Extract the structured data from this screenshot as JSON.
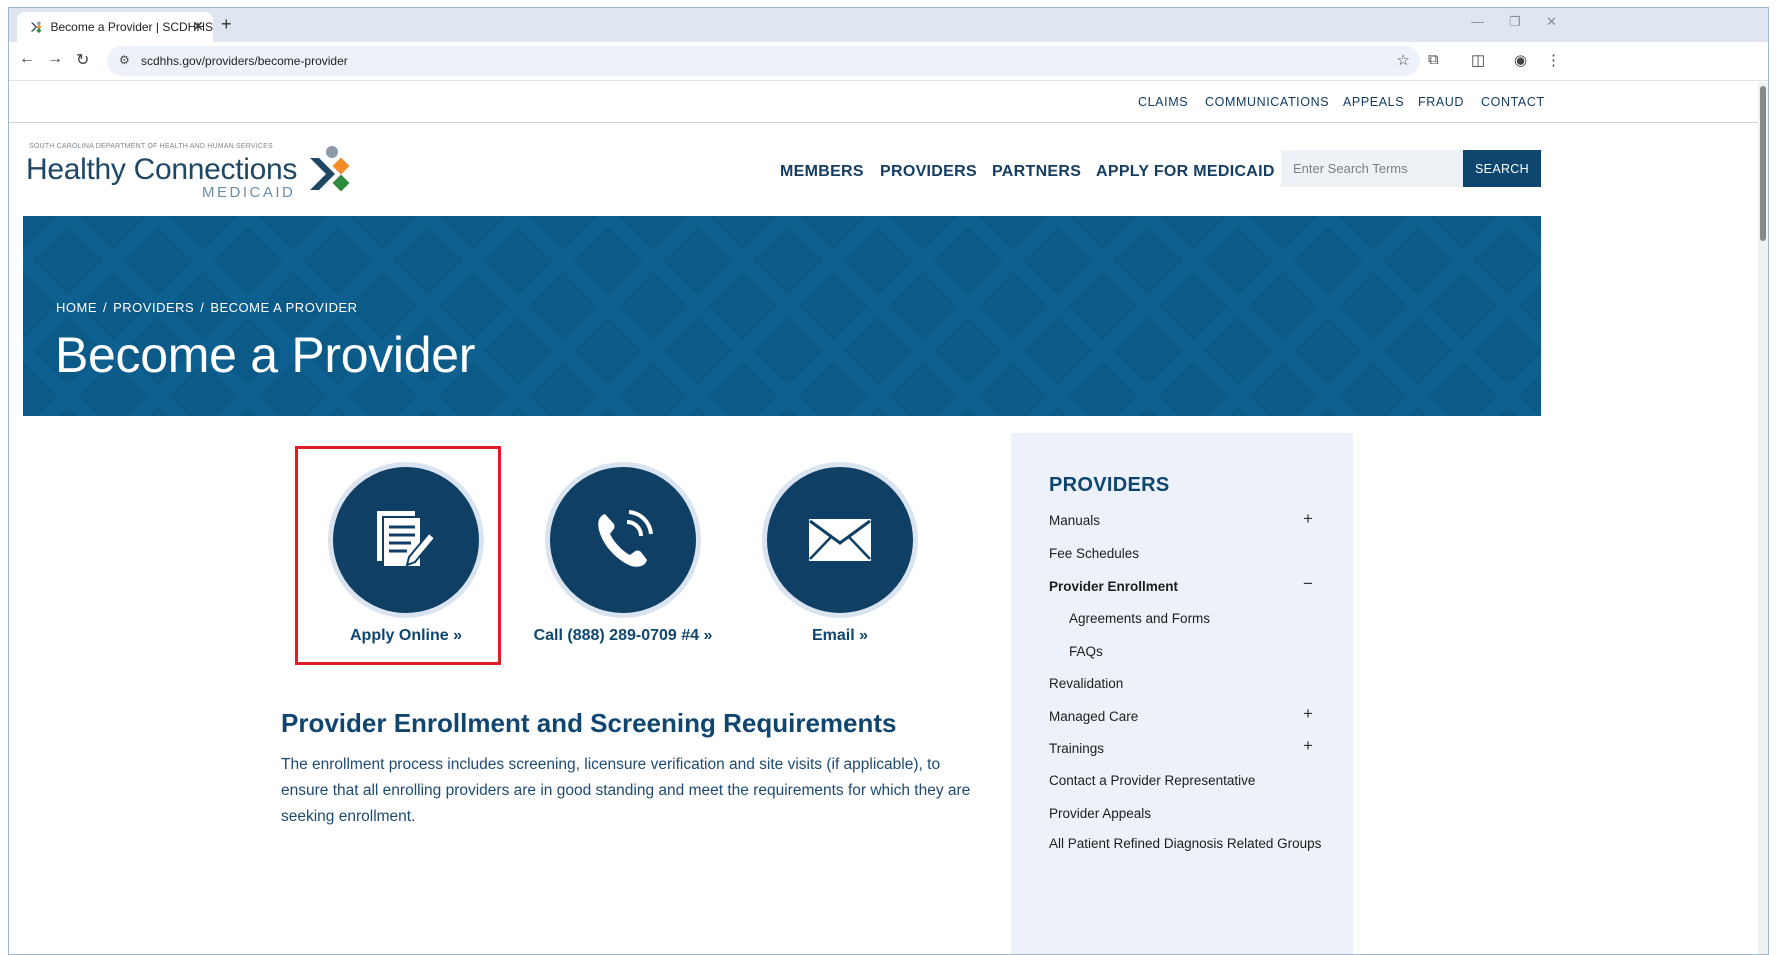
{
  "browser": {
    "tab_title": "Become a Provider | SCDHHS",
    "url": "scdhhs.gov/providers/become-provider"
  },
  "utility_nav": [
    "CLAIMS",
    "COMMUNICATIONS",
    "APPEALS",
    "FRAUD",
    "CONTACT"
  ],
  "logo": {
    "dept": "SOUTH CAROLINA DEPARTMENT OF HEALTH AND HUMAN SERVICES",
    "name": "Healthy Connections",
    "sub": "MEDICAID",
    "colors": {
      "navy": "#1e4766",
      "orange": "#f28c28",
      "green": "#2e8b3e",
      "gray": "#8a9aa8"
    }
  },
  "main_nav": [
    "MEMBERS",
    "PROVIDERS",
    "PARTNERS",
    "APPLY FOR MEDICAID"
  ],
  "search": {
    "placeholder": "Enter Search Terms",
    "button": "SEARCH"
  },
  "hero": {
    "breadcrumb": [
      "HOME",
      "PROVIDERS",
      "BECOME A PROVIDER"
    ],
    "title": "Become a Provider",
    "color": "#0b5a88"
  },
  "actions": [
    {
      "label": "Apply Online »",
      "icon": "document-pen-icon"
    },
    {
      "label": "Call (888) 289-0709 #4 »",
      "icon": "phone-icon"
    },
    {
      "label": "Email »",
      "icon": "envelope-icon"
    }
  ],
  "content": {
    "heading": "Provider Enrollment and Screening Requirements",
    "paragraph": "The enrollment process includes screening, licensure verification and site visits (if applicable), to ensure that all enrolling providers are in good standing and meet the requirements for which they are seeking enrollment."
  },
  "sidebar": {
    "heading": "PROVIDERS",
    "items": [
      {
        "label": "Manuals",
        "toggle": "+"
      },
      {
        "label": "Fee Schedules",
        "toggle": ""
      },
      {
        "label": "Provider Enrollment",
        "toggle": "−"
      },
      {
        "label": "Agreements and Forms",
        "toggle": ""
      },
      {
        "label": "FAQs",
        "toggle": ""
      },
      {
        "label": "Revalidation",
        "toggle": ""
      },
      {
        "label": "Managed Care",
        "toggle": "+"
      },
      {
        "label": "Trainings",
        "toggle": "+"
      },
      {
        "label": "Contact a Provider Representative",
        "toggle": ""
      },
      {
        "label": "Provider Appeals",
        "toggle": ""
      },
      {
        "label": "All Patient Refined Diagnosis Related Groups",
        "toggle": ""
      }
    ]
  },
  "highlight_color": "#dc1f26"
}
